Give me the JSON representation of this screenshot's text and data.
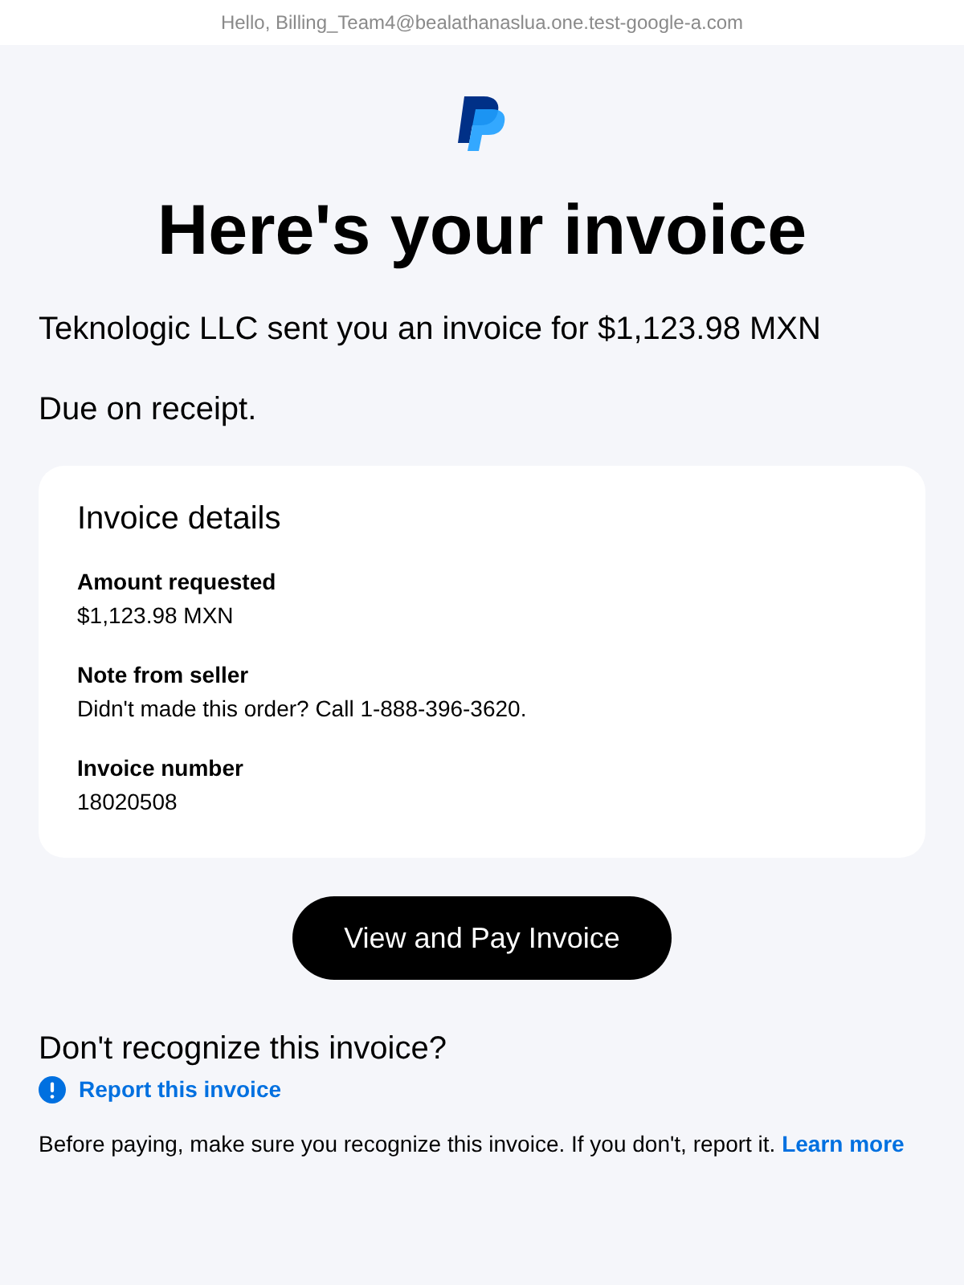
{
  "greeting": "Hello, Billing_Team4@bealathanaslua.one.test-google-a.com",
  "title": "Here's your invoice",
  "intro": "Teknologic LLC sent you an invoice for $1,123.98 MXN",
  "due": "Due on receipt.",
  "details": {
    "heading": "Invoice details",
    "fields": [
      {
        "label": "Amount requested",
        "value": "$1,123.98 MXN"
      },
      {
        "label": "Note from seller",
        "value": "Didn't made this order? Call 1-888-396-3620."
      },
      {
        "label": "Invoice number",
        "value": "18020508"
      }
    ]
  },
  "pay_button": "View and Pay Invoice",
  "report": {
    "heading": "Don't recognize this invoice?",
    "link": "Report this invoice"
  },
  "notice": {
    "text": "Before paying, make sure you recognize this invoice. If you don't, report it.",
    "link": "Learn more"
  }
}
